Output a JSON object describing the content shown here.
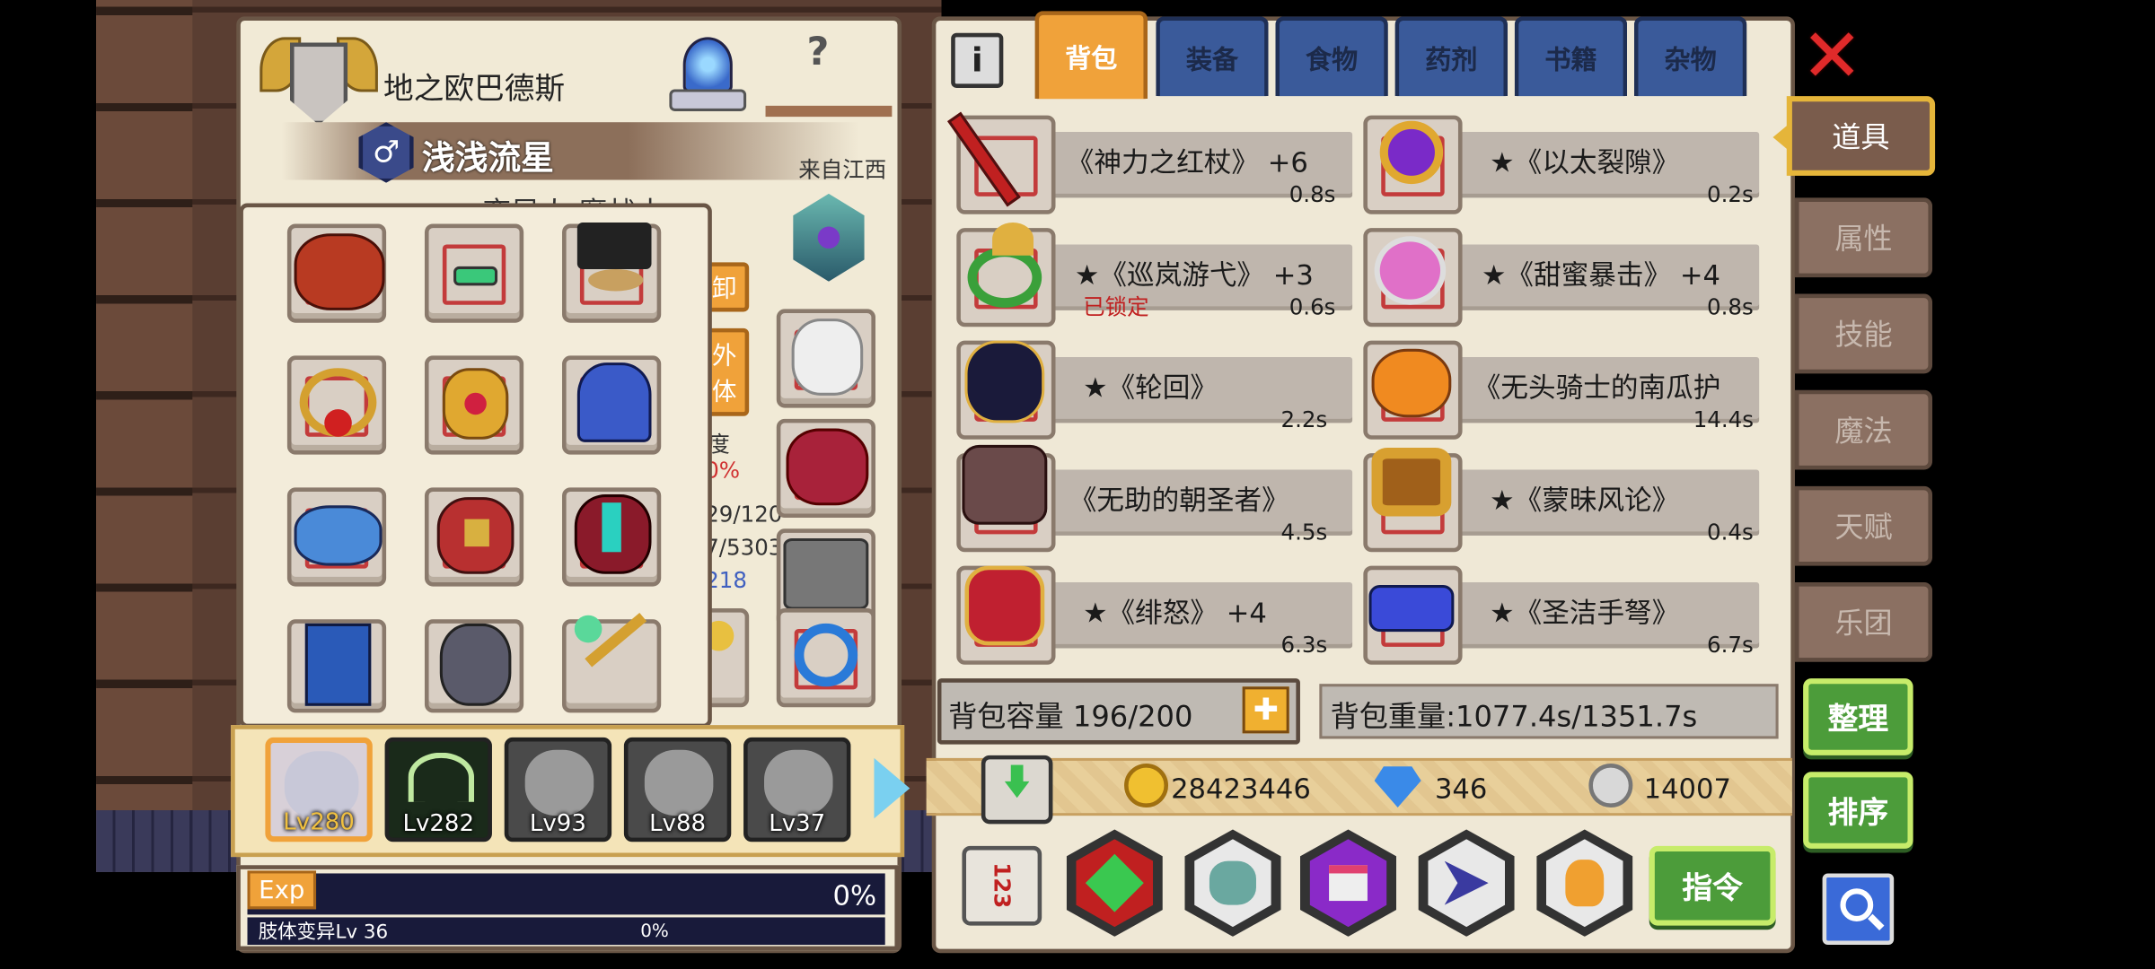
{
  "character": {
    "title": "地之欧巴德斯",
    "name": "浅浅流星",
    "origin": "来自江西",
    "race_class": "变异人 魔战士",
    "partial": {
      "btn1": "卸",
      "btn2a": "外",
      "btn2b": "体",
      "stat_label": "度",
      "stat_pct": "0%",
      "stat1": "29/120",
      "stat2": "7/5303",
      "stat3": "218"
    }
  },
  "party": [
    {
      "level": "Lv280",
      "selected": true
    },
    {
      "level": "Lv282",
      "selected": false
    },
    {
      "level": "Lv93",
      "selected": false
    },
    {
      "level": "Lv88",
      "selected": false
    },
    {
      "level": "Lv37",
      "selected": false
    }
  ],
  "exp": {
    "label": "Exp",
    "percent": "0%",
    "mutation_label": "肢体变异Lv 36",
    "mutation_percent": "0%"
  },
  "tabs": [
    {
      "label": "背包",
      "active": true
    },
    {
      "label": "装备",
      "active": false
    },
    {
      "label": "食物",
      "active": false
    },
    {
      "label": "药剂",
      "active": false
    },
    {
      "label": "书籍",
      "active": false
    },
    {
      "label": "杂物",
      "active": false
    }
  ],
  "info_icon": "i",
  "items": [
    {
      "name": "《神力之红杖》 +6",
      "time": "0.8s",
      "locked": "",
      "icon": "red-staff-icon"
    },
    {
      "name": "★《以太裂隙》",
      "time": "0.2s",
      "locked": "",
      "icon": "purple-gem-ring-icon"
    },
    {
      "name": "★《巡岚游弋》 +3",
      "time": "0.6s",
      "locked": "已锁定",
      "icon": "green-ring-icon"
    },
    {
      "name": "★《甜蜜暴击》 +4",
      "time": "0.8s",
      "locked": "",
      "icon": "pink-heart-ring-icon"
    },
    {
      "name": "★《轮回》",
      "time": "2.2s",
      "locked": "",
      "icon": "dark-gauntlet-icon"
    },
    {
      "name": "《无头骑士的南瓜护",
      "time": "14.4s",
      "locked": "",
      "icon": "pumpkin-icon"
    },
    {
      "name": "《无助的朝圣者》",
      "time": "4.5s",
      "locked": "",
      "icon": "spiked-helmet-icon"
    },
    {
      "name": "★《蒙昧风论》",
      "time": "0.4s",
      "locked": "",
      "icon": "gold-ring-icon"
    },
    {
      "name": "★《绯怒》 +4",
      "time": "6.3s",
      "locked": "",
      "icon": "red-crown-icon"
    },
    {
      "name": "★《圣洁手弩》",
      "time": "6.7s",
      "locked": "",
      "icon": "crossbow-icon"
    }
  ],
  "capacity": {
    "label": "背包容量 196/200",
    "plus": "✚"
  },
  "weight": {
    "label": "背包重量:1077.4s/1351.7s"
  },
  "currency": {
    "gold": "28423446",
    "gems": "346",
    "silver": "14007"
  },
  "side_tabs": [
    {
      "label": "道具",
      "active": true
    },
    {
      "label": "属性",
      "active": false
    },
    {
      "label": "技能",
      "active": false
    },
    {
      "label": "魔法",
      "active": false
    },
    {
      "label": "天赋",
      "active": false
    },
    {
      "label": "乐团",
      "active": false
    }
  ],
  "buttons": {
    "sort": "整理",
    "order": "排序",
    "command": "指令",
    "hotkey": "123"
  },
  "close_icon": "✕",
  "colors": {
    "parchment": "#f1ead6",
    "tab_active": "#f0a23a",
    "tab_inactive": "#3a5a9a",
    "green_button": "#4c9c3a",
    "locked_red": "#c02020"
  }
}
